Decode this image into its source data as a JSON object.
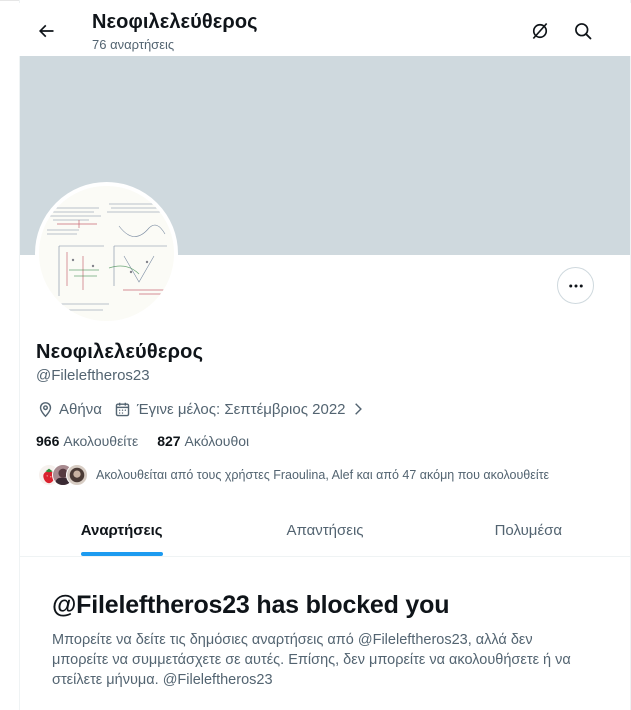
{
  "header": {
    "title": "Νεοφιλελεύθερος",
    "post_count": "76 αναρτήσεις",
    "back_icon": "arrow-left-icon",
    "grok_icon": "grok-icon",
    "search_icon": "search-icon"
  },
  "profile": {
    "name": "Νεοφιλελεύθερος",
    "handle": "@Fileleftheros23",
    "location": "Αθήνα",
    "joined": "Έγινε μέλος: Σεπτέμβριος 2022",
    "following_count": "966",
    "following_label": "Ακολουθείτε",
    "followers_count": "827",
    "followers_label": "Ακόλουθοι",
    "followed_by_text": "Ακολουθείται από τους χρήστες Fraoulina, Alef και από 47 ακόμη που ακολουθείτε"
  },
  "tabs": [
    {
      "label": "Αναρτήσεις",
      "active": true
    },
    {
      "label": "Απαντήσεις",
      "active": false
    },
    {
      "label": "Πολυμέσα",
      "active": false
    }
  ],
  "blocked": {
    "title": "@Fileleftheros23 has blocked you",
    "description": "Μπορείτε να δείτε τις δημόσιες αναρτήσεις από @Fileleftheros23, αλλά δεν μπορείτε να συμμετάσχετε σε αυτές. Επίσης, δεν μπορείτε να ακολουθήσετε ή να στείλετε μήνυμα. @Fileleftheros23"
  },
  "colors": {
    "accent": "#1d9bf0",
    "banner": "#cfd9de",
    "secondary_text": "#536471",
    "primary_text": "#0f1419"
  }
}
